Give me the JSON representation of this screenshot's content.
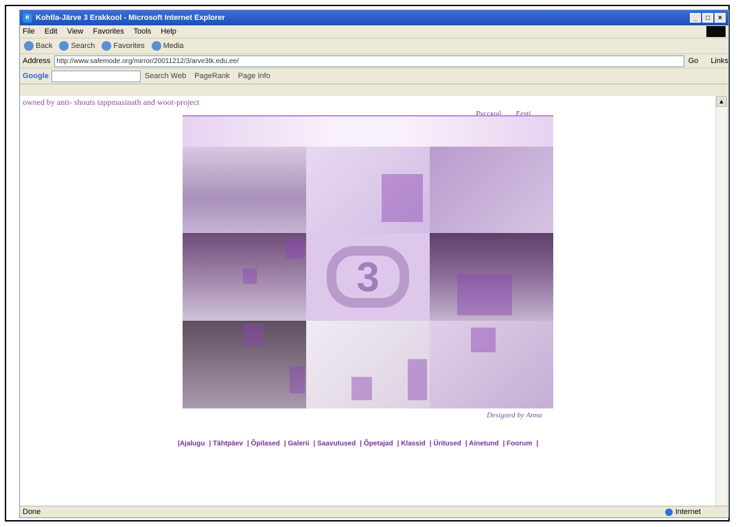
{
  "window": {
    "title": "Kohtla-Järve 3 Erakkool - Microsoft Internet Explorer",
    "min": "_",
    "max": "□",
    "close": "×"
  },
  "menu": [
    "File",
    "Edit",
    "View",
    "Favorites",
    "Tools",
    "Help"
  ],
  "toolbar": [
    "Back",
    "Search",
    "Favorites",
    "Media"
  ],
  "address": {
    "label": "Address",
    "url": "http://www.safemode.org/mirror/20011212/3/arve3tk.edu.ee/",
    "go": "Go",
    "links": "Links"
  },
  "google": {
    "logo": "Google",
    "search_web": "Search Web",
    "pagerank": "PageRank",
    "page_info": "Page Info"
  },
  "page": {
    "owned_by": "owned by anti- shouts tappmasinath and woot-project",
    "languages": [
      "Русский",
      "Eesti"
    ],
    "designed_by": "Designed by Anna",
    "logo_text": "3",
    "nav": [
      "Ajalugu",
      "Tähtpäev",
      "Õpilased",
      "Galerii",
      "Saavutused",
      "Õpetajad",
      "Klassid",
      "Üritused",
      "Ainetund",
      "Foorum"
    ]
  },
  "status": {
    "text": "Done",
    "zone": "Internet"
  }
}
